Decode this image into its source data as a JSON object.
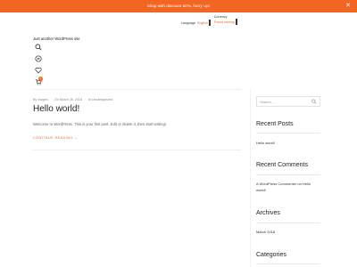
{
  "announcement": {
    "text": "Shop with discount 50%, hurry Up!",
    "close": "✕"
  },
  "selectors": {
    "language_label": "Language",
    "language_value": "English",
    "currency_label": "Currency",
    "currency_value": "Pound sterling"
  },
  "site": {
    "title": "Just another WordPress site"
  },
  "header_icons": [
    {
      "name": "search-icon"
    },
    {
      "name": "compare-icon"
    },
    {
      "name": "wishlist-heart-icon"
    },
    {
      "name": "cart-icon",
      "badge": "0"
    }
  ],
  "post": {
    "author": "By vkagen",
    "date": "On March 26, 2018",
    "category": "In Uncategorized",
    "title": "Hello world!",
    "excerpt": "Welcome to WordPress. This is your first post. Edit or delete it, then start writing!",
    "read_more": "CONTINUE READING",
    "read_more_arrow": "→"
  },
  "sidebar": {
    "search_placeholder": "Search ...",
    "recent_posts": {
      "title": "Recent Posts",
      "items": [
        "Hello world!"
      ]
    },
    "recent_comments": {
      "title": "Recent Comments",
      "line1": "A WordPress Commenter on Hello",
      "line2": "world!"
    },
    "archives": {
      "title": "Archives",
      "items": [
        "March 2018"
      ]
    },
    "categories": {
      "title": "Categories"
    }
  },
  "colors": {
    "accent": "#f26522",
    "text": "#222222"
  }
}
